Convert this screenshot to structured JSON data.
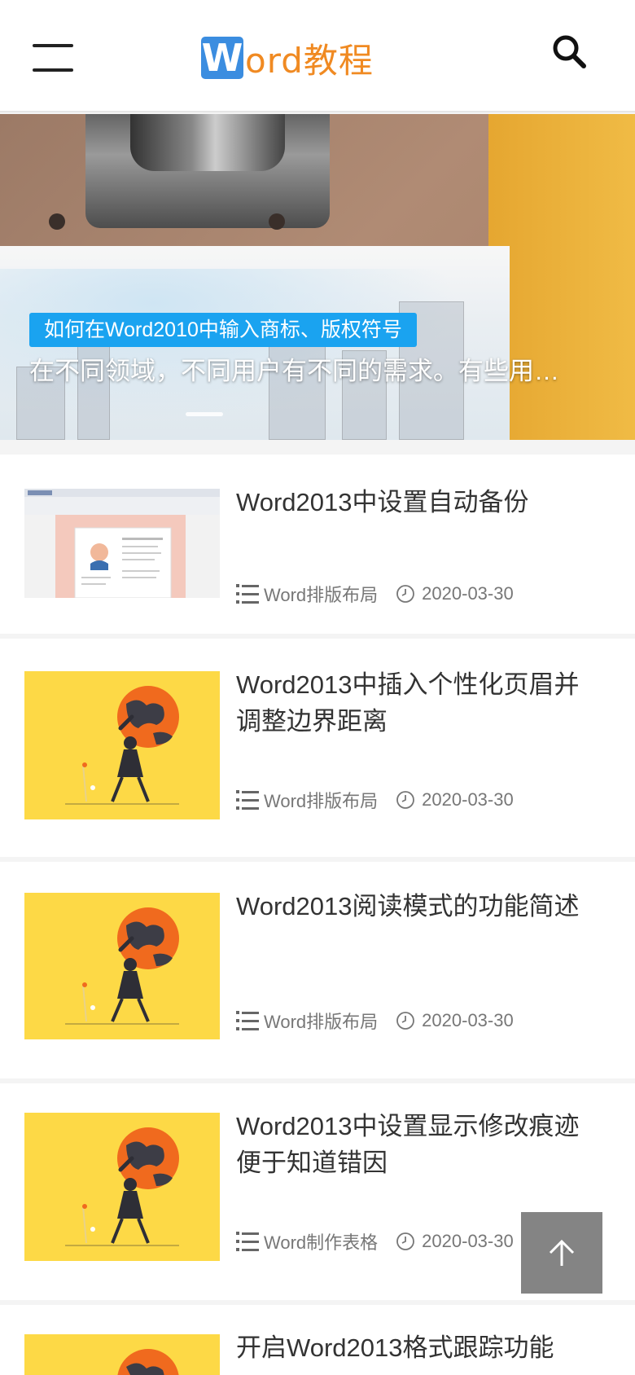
{
  "header": {
    "logo_letter": "W",
    "logo_text": "ord教程",
    "menu_icon": "hamburger-menu-icon",
    "search_icon": "search-icon"
  },
  "banner": {
    "tag": "如何在Word2010中输入商标、版权符号",
    "description": "在不同领域，不同用户有不同的需求。有些用户需要在文档中输入商标、版权等符号，该如何操作呢？",
    "tag_color": "#1aa3f0"
  },
  "articles": [
    {
      "title": "Word2013中设置自动备份",
      "category": "Word排版布局",
      "date": "2020-03-30",
      "thumb": "resume-screenshot"
    },
    {
      "title": "Word2013中插入个性化页眉并调整边界距离",
      "category": "Word排版布局",
      "date": "2020-03-30",
      "thumb": "globe-illustration"
    },
    {
      "title": "Word2013阅读模式的功能简述",
      "category": "Word排版布局",
      "date": "2020-03-30",
      "thumb": "globe-illustration"
    },
    {
      "title": "Word2013中设置显示修改痕迹便于知道错因",
      "category": "Word制作表格",
      "date": "2020-03-30",
      "thumb": "globe-illustration"
    },
    {
      "title": "开启Word2013格式跟踪功能",
      "category": "",
      "date": "",
      "thumb": "globe-illustration"
    }
  ],
  "colors": {
    "logo_blue": "#3b8de0",
    "logo_orange": "#f08a22",
    "thumb_yellow": "#fdd946",
    "globe_orange": "#f06a1e"
  },
  "back_to_top_icon": "arrow-up-icon"
}
